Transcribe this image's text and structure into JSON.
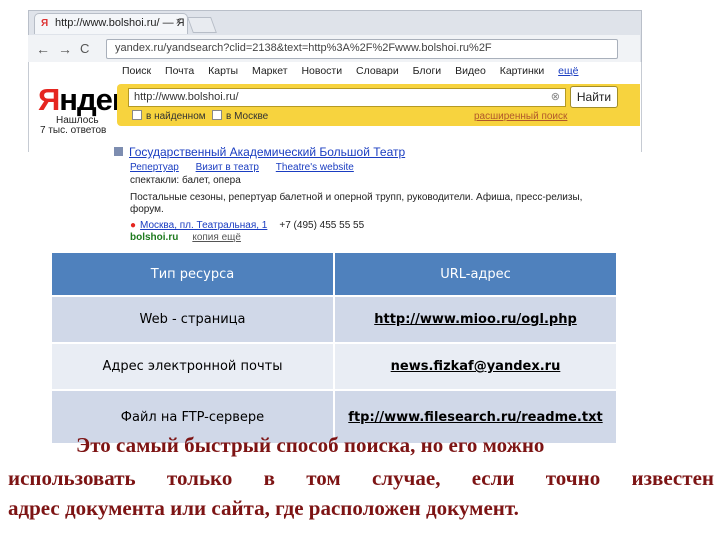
{
  "browser": {
    "tab_icon": "Я",
    "tab_title": "http://www.bolshoi.ru/ — Я",
    "tab_close": "×",
    "back": "←",
    "forward": "→",
    "reload": "C",
    "address": "yandex.ru/yandsearch?clid=2138&text=http%3A%2F%2Fwww.bolshoi.ru%2F"
  },
  "yandex": {
    "nav": [
      "Поиск",
      "Почта",
      "Карты",
      "Маркет",
      "Новости",
      "Словари",
      "Блоги",
      "Видео",
      "Картинки"
    ],
    "nav_more": "ещё",
    "logo_first": "Я",
    "logo_rest": "ндекс",
    "found_line1": "Нашлось",
    "found_line2": "7 тыс. ответов",
    "search_value": "http://www.bolshoi.ru/",
    "search_button": "Найти",
    "check_region": "в найденном",
    "check_city": "в Москве",
    "advanced": "расширенный поиск"
  },
  "result": {
    "title": "Государственный Академический Большой Театр",
    "links": [
      "Репертуар",
      "Визит в театр",
      "Theatre's website"
    ],
    "lines": [
      "спектакли: балет, опера",
      "Постальные сезоны, репертуар балетной и оперной трупп, руководители. Афиша, пресс-релизы,",
      "форум."
    ],
    "address": "Москва, пл. Театральная, 1",
    "phone": "+7 (495) 455 55 55",
    "domain": "bolshoi.ru",
    "cache": "копия  ещё"
  },
  "table": {
    "headers": [
      "Тип ресурса",
      "URL-адрес"
    ],
    "rows": [
      {
        "type": "Web - страница",
        "url": "http://www.mioo.ru/ogl.php"
      },
      {
        "type": "Адрес электронной почты",
        "url": "news.fizkaf@yandex.ru"
      },
      {
        "type": "Файл на FTP-сервере",
        "url": "ftp://www.filesearch.ru/readme.txt"
      }
    ]
  },
  "caption": {
    "line1": "Это самый быстрый способ поиска, но его можно",
    "line2": "использовать только в том случае, если точно известен",
    "line3": "адрес документа или сайта, где расположен документ."
  }
}
